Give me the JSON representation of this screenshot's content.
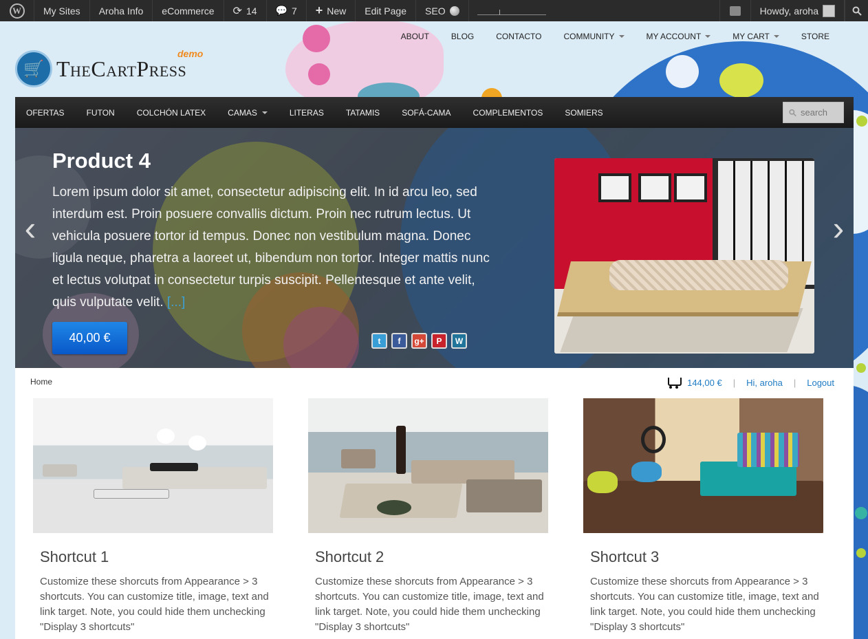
{
  "admin_bar": {
    "my_sites": "My Sites",
    "site_name": "Aroha Info",
    "ecommerce": "eCommerce",
    "updates_count": "14",
    "comments_count": "7",
    "new_label": "New",
    "edit_page": "Edit Page",
    "seo": "SEO",
    "howdy": "Howdy, aroha"
  },
  "logo": {
    "text": "TheCartPress",
    "demo": "demo"
  },
  "top_menu": [
    {
      "label": "ABOUT",
      "dropdown": false
    },
    {
      "label": "BLOG",
      "dropdown": false
    },
    {
      "label": "CONTACTO",
      "dropdown": false
    },
    {
      "label": "COMMUNITY",
      "dropdown": true
    },
    {
      "label": "MY ACCOUNT",
      "dropdown": true
    },
    {
      "label": "MY CART",
      "dropdown": true
    },
    {
      "label": "STORE",
      "dropdown": false
    }
  ],
  "category_menu": [
    {
      "label": "OFERTAS",
      "dropdown": false
    },
    {
      "label": "FUTON",
      "dropdown": false
    },
    {
      "label": "COLCHÓN LATEX",
      "dropdown": false
    },
    {
      "label": "CAMAS",
      "dropdown": true
    },
    {
      "label": "LITERAS",
      "dropdown": false
    },
    {
      "label": "TATAMIS",
      "dropdown": false
    },
    {
      "label": "SOFÁ-CAMA",
      "dropdown": false
    },
    {
      "label": "COMPLEMENTOS",
      "dropdown": false
    },
    {
      "label": "SOMIERS",
      "dropdown": false
    }
  ],
  "search": {
    "placeholder": "search"
  },
  "slider": {
    "title": "Product 4",
    "text": "Lorem ipsum dolor sit amet, consectetur adipiscing elit. In id arcu leo, sed interdum est. Proin posuere convallis dictum. Proin nec rutrum lectus. Ut vehicula posuere tortor id tempus. Donec non vestibulum magna. Donec ligula neque, pharetra a laoreet ut, bibendum non tortor. Integer mattis nunc et lectus volutpat in consectetur turpis suscipit. Pellentesque et ante velit, quis vulputate velit.",
    "more": "[...]",
    "price": "40,00 €",
    "social_icons": [
      "twitter-icon",
      "facebook-icon",
      "google-plus-icon",
      "pinterest-icon",
      "wordpress-icon"
    ]
  },
  "breadcrumb": {
    "home": "Home"
  },
  "user_bar": {
    "cart_total": "144,00 €",
    "greeting": "Hi, aroha",
    "logout": "Logout"
  },
  "shortcuts": [
    {
      "title": "Shortcut 1",
      "text": "Customize these shorcuts from Appearance > 3 shortcuts. You can customize title, image, text and link target. Note, you could hide them unchecking \"Display 3 shortcuts\""
    },
    {
      "title": "Shortcut 2",
      "text": "Customize these shorcuts from Appearance > 3 shortcuts. You can customize title, image, text and link target. Note, you could hide them unchecking \"Display 3 shortcuts\""
    },
    {
      "title": "Shortcut 3",
      "text": "Customize these shorcuts from Appearance > 3 shortcuts. You can customize title, image, text and link target. Note, you could hide them unchecking \"Display 3 shortcuts\""
    }
  ],
  "colors": {
    "admin_bar_bg": "#2b2b2b",
    "nav_bg": "#222222",
    "link_blue": "#1f7cc4",
    "price_button": "#0a62d0",
    "demo_orange": "#f08a1e"
  }
}
